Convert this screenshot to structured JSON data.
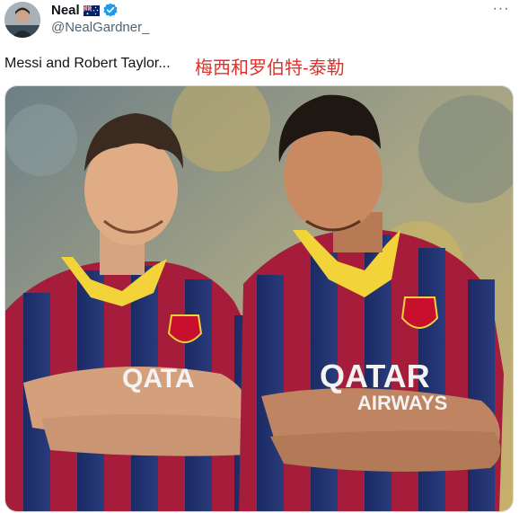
{
  "author": {
    "display_name": "Neal",
    "handle": "@NealGardner_",
    "flag_icon": "australia-flag-icon",
    "verified_icon": "verified-badge-icon",
    "verified_color": "#1d9bf0"
  },
  "tweet": {
    "text": "Messi and Robert Taylor...",
    "translation": "梅西和罗伯特-泰勒",
    "translation_color": "#e0322a"
  },
  "menu": {
    "more_label": "···"
  },
  "photo": {
    "jersey_text_left": "QATA",
    "jersey_text_right_line1": "QATAR",
    "jersey_text_right_line2": "AIRWAYS"
  }
}
